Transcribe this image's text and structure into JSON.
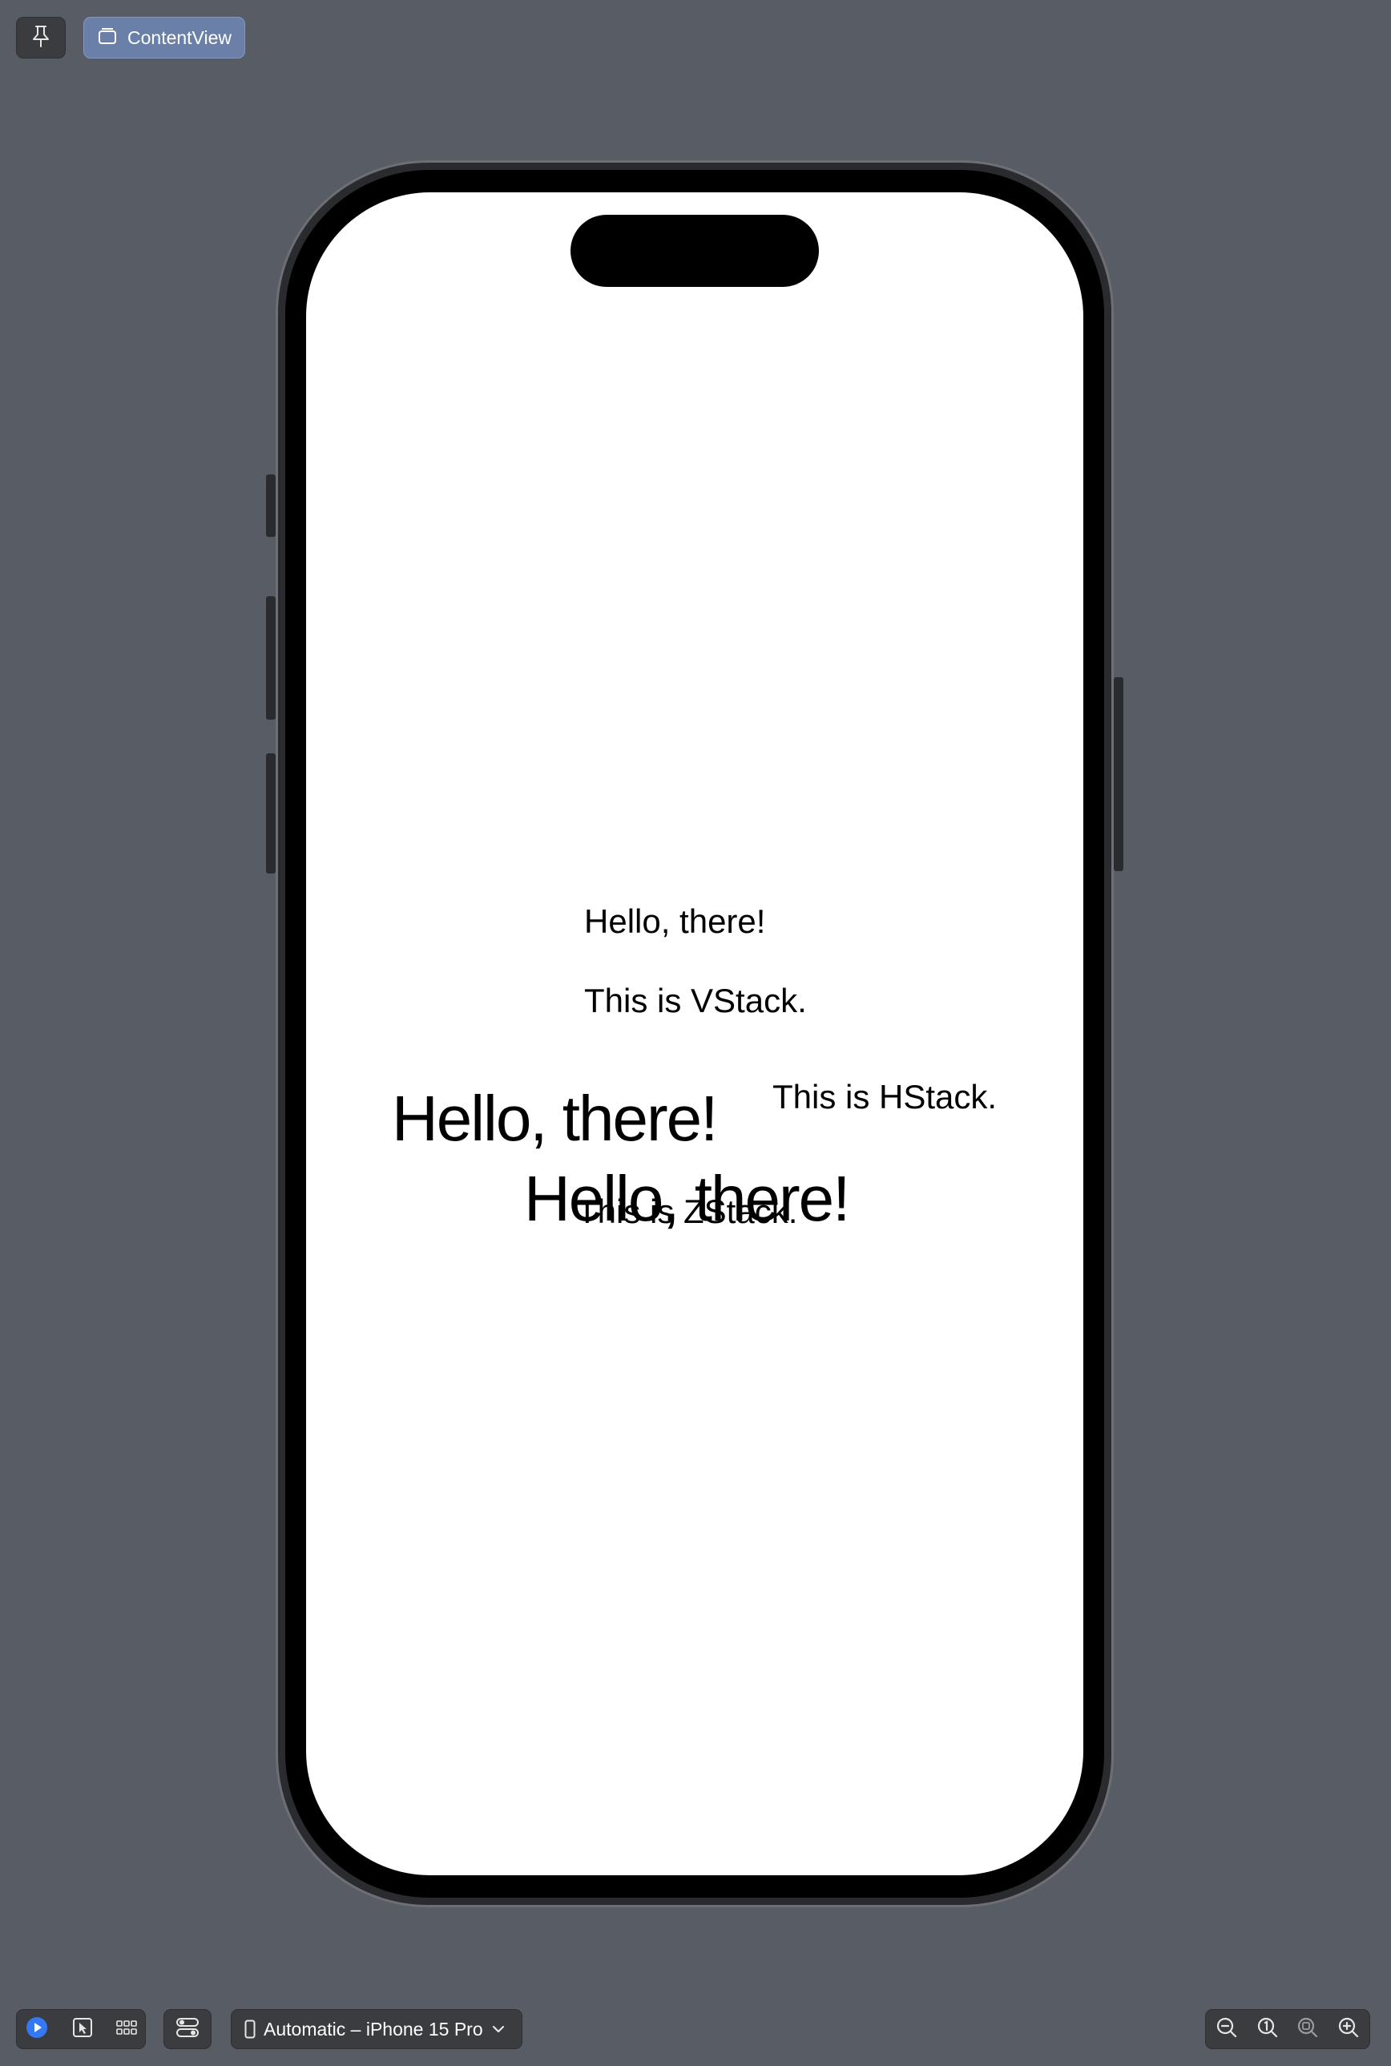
{
  "toolbar": {
    "pin_icon": "pin-icon",
    "content_view_label": "ContentView"
  },
  "preview": {
    "vstack_hello": "Hello, there!",
    "vstack_label": "This is VStack.",
    "hstack_hello": "Hello, there!",
    "hstack_label": "This is HStack.",
    "zstack_hello": "Hello, there!",
    "zstack_label": "This is ZStack."
  },
  "bottom_bar": {
    "device_label": "Automatic – iPhone 15 Pro",
    "accent_color": "#3478f6"
  }
}
